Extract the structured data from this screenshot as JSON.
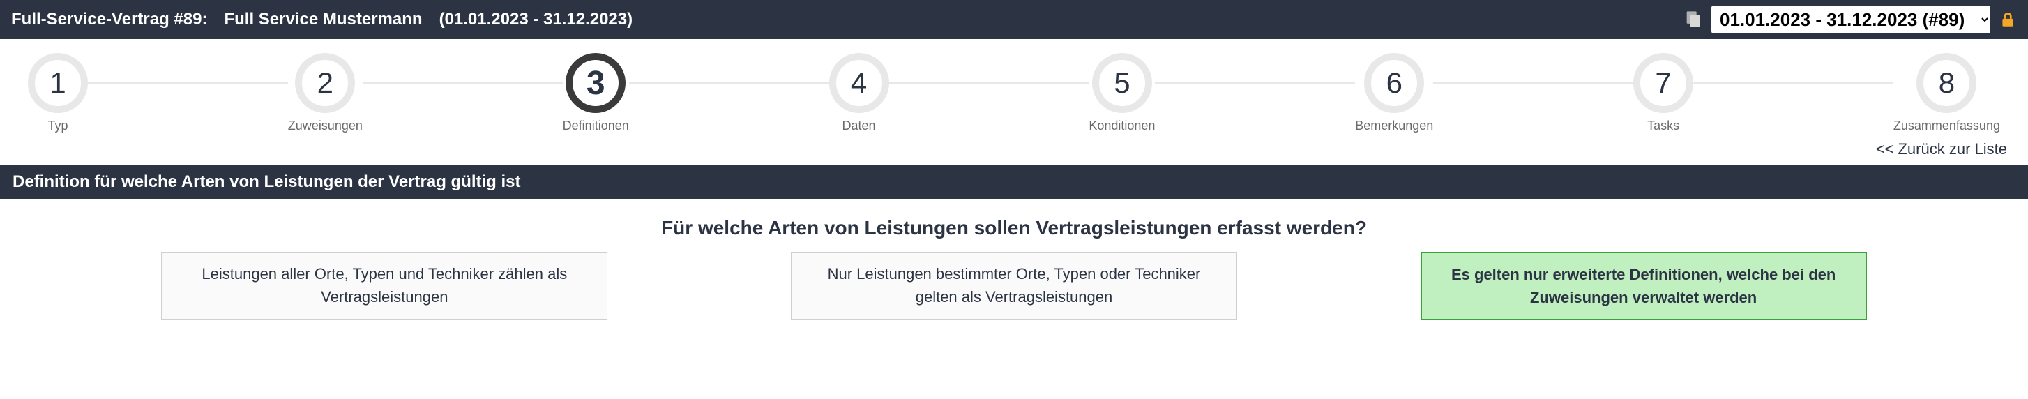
{
  "header": {
    "contract_label": "Full-Service-Vertrag #89:",
    "contract_name": "Full Service Mustermann",
    "period": "(01.01.2023 - 31.12.2023)",
    "period_select": "01.01.2023 - 31.12.2023 (#89)"
  },
  "steps": [
    {
      "num": "1",
      "label": "Typ"
    },
    {
      "num": "2",
      "label": "Zuweisungen"
    },
    {
      "num": "3",
      "label": "Definitionen"
    },
    {
      "num": "4",
      "label": "Daten"
    },
    {
      "num": "5",
      "label": "Konditionen"
    },
    {
      "num": "6",
      "label": "Bemerkungen"
    },
    {
      "num": "7",
      "label": "Tasks"
    },
    {
      "num": "8",
      "label": "Zusammenfassung"
    }
  ],
  "active_step": 2,
  "back_link": "<< Zurück zur Liste",
  "section_title": "Definition für welche Arten von Leistungen der Vertrag gültig ist",
  "question": "Für welche Arten von Leistungen sollen Vertragsleistungen erfasst werden?",
  "options": [
    "Leistungen aller Orte, Typen und Techniker zählen als Vertragsleistungen",
    "Nur Leistungen bestimmter Orte, Typen oder Techniker gelten als Vertragsleistungen",
    "Es gelten nur erweiterte Definitionen, welche bei den Zuweisungen verwaltet werden"
  ],
  "selected_option": 2
}
